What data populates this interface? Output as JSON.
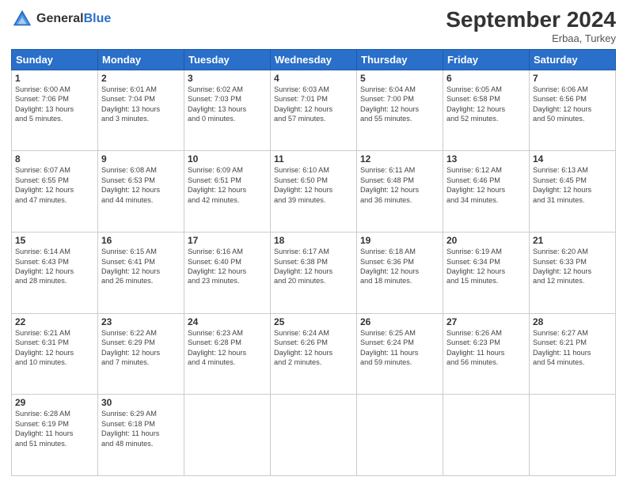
{
  "header": {
    "logo_general": "General",
    "logo_blue": "Blue",
    "month_title": "September 2024",
    "location": "Erbaa, Turkey"
  },
  "days_of_week": [
    "Sunday",
    "Monday",
    "Tuesday",
    "Wednesday",
    "Thursday",
    "Friday",
    "Saturday"
  ],
  "weeks": [
    [
      {
        "num": "1",
        "info": "Sunrise: 6:00 AM\nSunset: 7:06 PM\nDaylight: 13 hours\nand 5 minutes."
      },
      {
        "num": "2",
        "info": "Sunrise: 6:01 AM\nSunset: 7:04 PM\nDaylight: 13 hours\nand 3 minutes."
      },
      {
        "num": "3",
        "info": "Sunrise: 6:02 AM\nSunset: 7:03 PM\nDaylight: 13 hours\nand 0 minutes."
      },
      {
        "num": "4",
        "info": "Sunrise: 6:03 AM\nSunset: 7:01 PM\nDaylight: 12 hours\nand 57 minutes."
      },
      {
        "num": "5",
        "info": "Sunrise: 6:04 AM\nSunset: 7:00 PM\nDaylight: 12 hours\nand 55 minutes."
      },
      {
        "num": "6",
        "info": "Sunrise: 6:05 AM\nSunset: 6:58 PM\nDaylight: 12 hours\nand 52 minutes."
      },
      {
        "num": "7",
        "info": "Sunrise: 6:06 AM\nSunset: 6:56 PM\nDaylight: 12 hours\nand 50 minutes."
      }
    ],
    [
      {
        "num": "8",
        "info": "Sunrise: 6:07 AM\nSunset: 6:55 PM\nDaylight: 12 hours\nand 47 minutes."
      },
      {
        "num": "9",
        "info": "Sunrise: 6:08 AM\nSunset: 6:53 PM\nDaylight: 12 hours\nand 44 minutes."
      },
      {
        "num": "10",
        "info": "Sunrise: 6:09 AM\nSunset: 6:51 PM\nDaylight: 12 hours\nand 42 minutes."
      },
      {
        "num": "11",
        "info": "Sunrise: 6:10 AM\nSunset: 6:50 PM\nDaylight: 12 hours\nand 39 minutes."
      },
      {
        "num": "12",
        "info": "Sunrise: 6:11 AM\nSunset: 6:48 PM\nDaylight: 12 hours\nand 36 minutes."
      },
      {
        "num": "13",
        "info": "Sunrise: 6:12 AM\nSunset: 6:46 PM\nDaylight: 12 hours\nand 34 minutes."
      },
      {
        "num": "14",
        "info": "Sunrise: 6:13 AM\nSunset: 6:45 PM\nDaylight: 12 hours\nand 31 minutes."
      }
    ],
    [
      {
        "num": "15",
        "info": "Sunrise: 6:14 AM\nSunset: 6:43 PM\nDaylight: 12 hours\nand 28 minutes."
      },
      {
        "num": "16",
        "info": "Sunrise: 6:15 AM\nSunset: 6:41 PM\nDaylight: 12 hours\nand 26 minutes."
      },
      {
        "num": "17",
        "info": "Sunrise: 6:16 AM\nSunset: 6:40 PM\nDaylight: 12 hours\nand 23 minutes."
      },
      {
        "num": "18",
        "info": "Sunrise: 6:17 AM\nSunset: 6:38 PM\nDaylight: 12 hours\nand 20 minutes."
      },
      {
        "num": "19",
        "info": "Sunrise: 6:18 AM\nSunset: 6:36 PM\nDaylight: 12 hours\nand 18 minutes."
      },
      {
        "num": "20",
        "info": "Sunrise: 6:19 AM\nSunset: 6:34 PM\nDaylight: 12 hours\nand 15 minutes."
      },
      {
        "num": "21",
        "info": "Sunrise: 6:20 AM\nSunset: 6:33 PM\nDaylight: 12 hours\nand 12 minutes."
      }
    ],
    [
      {
        "num": "22",
        "info": "Sunrise: 6:21 AM\nSunset: 6:31 PM\nDaylight: 12 hours\nand 10 minutes."
      },
      {
        "num": "23",
        "info": "Sunrise: 6:22 AM\nSunset: 6:29 PM\nDaylight: 12 hours\nand 7 minutes."
      },
      {
        "num": "24",
        "info": "Sunrise: 6:23 AM\nSunset: 6:28 PM\nDaylight: 12 hours\nand 4 minutes."
      },
      {
        "num": "25",
        "info": "Sunrise: 6:24 AM\nSunset: 6:26 PM\nDaylight: 12 hours\nand 2 minutes."
      },
      {
        "num": "26",
        "info": "Sunrise: 6:25 AM\nSunset: 6:24 PM\nDaylight: 11 hours\nand 59 minutes."
      },
      {
        "num": "27",
        "info": "Sunrise: 6:26 AM\nSunset: 6:23 PM\nDaylight: 11 hours\nand 56 minutes."
      },
      {
        "num": "28",
        "info": "Sunrise: 6:27 AM\nSunset: 6:21 PM\nDaylight: 11 hours\nand 54 minutes."
      }
    ],
    [
      {
        "num": "29",
        "info": "Sunrise: 6:28 AM\nSunset: 6:19 PM\nDaylight: 11 hours\nand 51 minutes."
      },
      {
        "num": "30",
        "info": "Sunrise: 6:29 AM\nSunset: 6:18 PM\nDaylight: 11 hours\nand 48 minutes."
      },
      {
        "num": "",
        "info": ""
      },
      {
        "num": "",
        "info": ""
      },
      {
        "num": "",
        "info": ""
      },
      {
        "num": "",
        "info": ""
      },
      {
        "num": "",
        "info": ""
      }
    ]
  ]
}
